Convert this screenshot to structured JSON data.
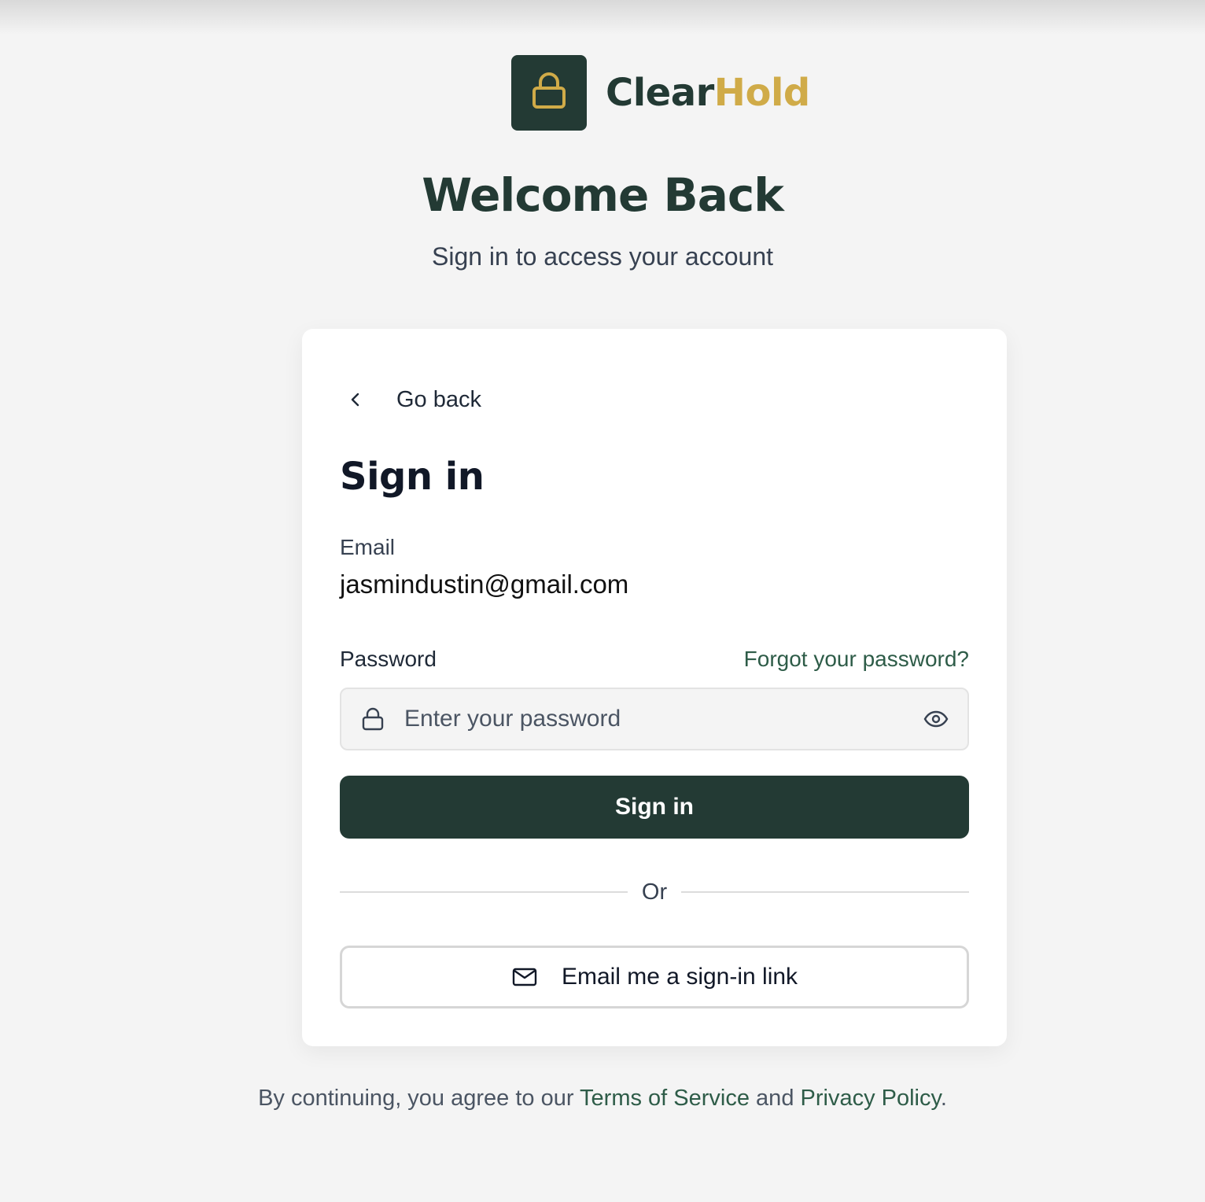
{
  "brand": {
    "name_part1": "Clear",
    "name_part2": "Hold",
    "logo_icon": "lock-icon"
  },
  "header": {
    "title": "Welcome Back",
    "subtitle": "Sign in to access your account"
  },
  "card": {
    "back_label": "Go back",
    "title": "Sign in",
    "email_label": "Email",
    "email_value": "jasmindustin@gmail.com",
    "password_label": "Password",
    "forgot_label": "Forgot your password?",
    "password_placeholder": "Enter your password",
    "submit_label": "Sign in",
    "divider_label": "Or",
    "magic_link_label": "Email me a sign-in link"
  },
  "footer": {
    "prefix": "By continuing, you agree to our ",
    "terms_label": "Terms of Service",
    "conjunction": " and ",
    "privacy_label": "Privacy Policy",
    "suffix": "."
  },
  "colors": {
    "primary": "#233a34",
    "accent": "#d0ab48",
    "link": "#2e5c48"
  }
}
